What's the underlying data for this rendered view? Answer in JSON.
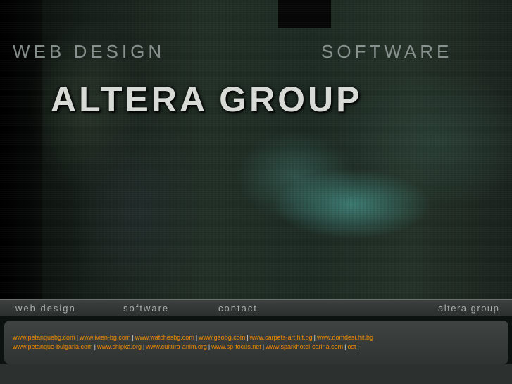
{
  "header": {
    "tagline_left": "WEB DESIGN",
    "tagline_right": "SOFTWARE",
    "brand": "ALTERA GROUP"
  },
  "nav": {
    "web_design": "web design",
    "software": "software",
    "contact": "contact",
    "altera_group": "altera group"
  },
  "links": {
    "row1": [
      "www.petanquebg.com",
      "www.ivien-bg.com",
      "www.watchesbg.com",
      "www.geobg.com",
      "www.carpets-art.hit.bg",
      "www.domdesi.hit.bg"
    ],
    "row2": [
      "www.petanque-bulgaria.com",
      "www.shipka.org",
      "www.cultura-anim.org",
      "www.sp-focus.net",
      "www.sparkhotel-carina.com",
      "ost"
    ]
  },
  "colors": {
    "link": "#f08a00",
    "nav_text": "#a9b0ad",
    "brand_text": "#d8dad6"
  }
}
